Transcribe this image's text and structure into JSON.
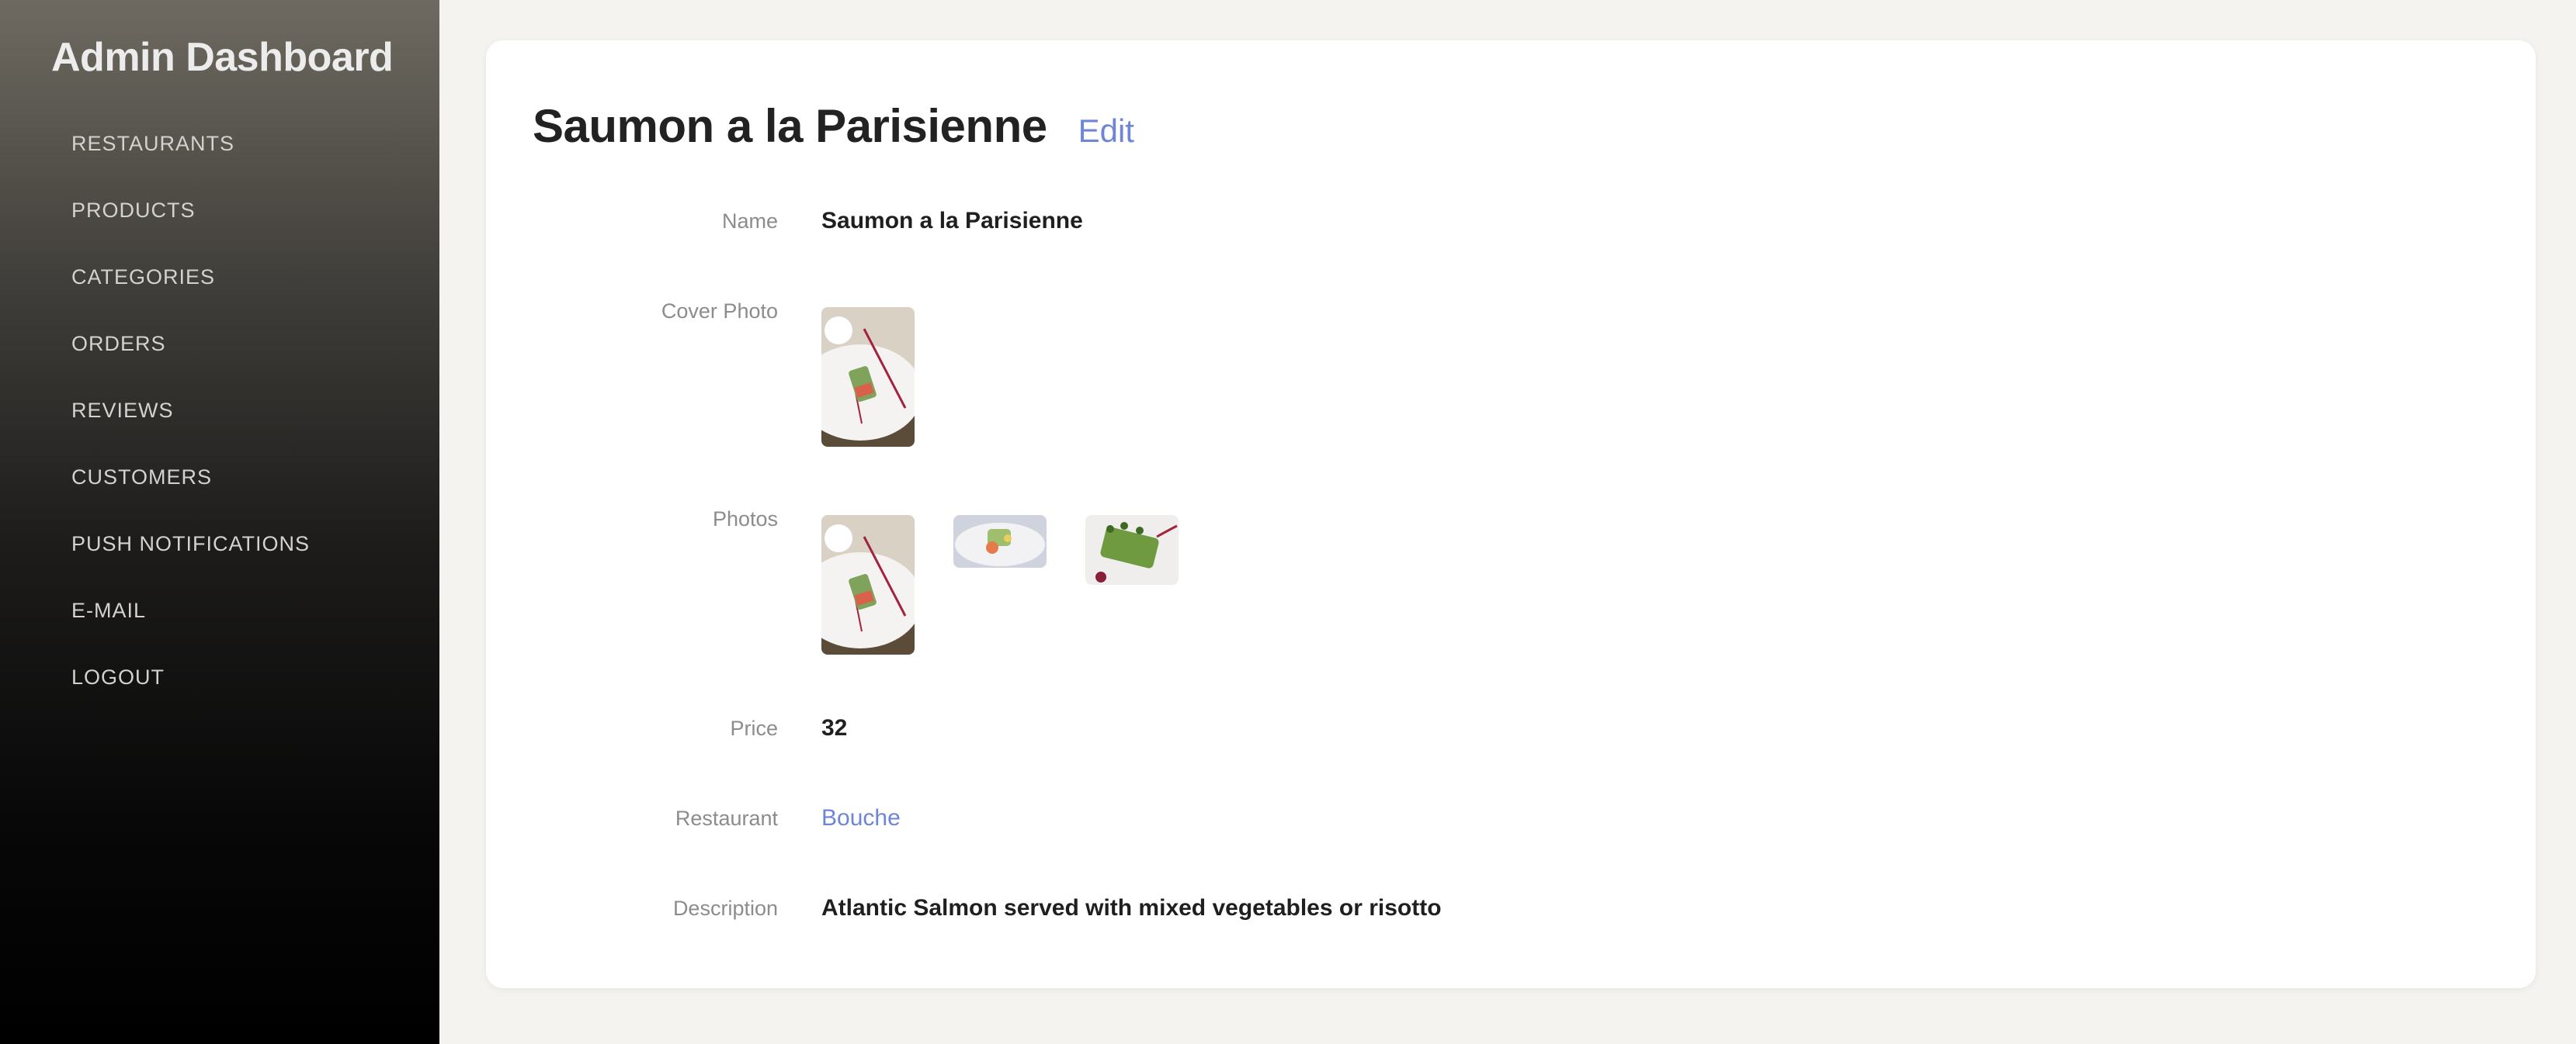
{
  "sidebar": {
    "title": "Admin Dashboard",
    "items": [
      {
        "label": "RESTAURANTS"
      },
      {
        "label": "PRODUCTS"
      },
      {
        "label": "CATEGORIES"
      },
      {
        "label": "ORDERS"
      },
      {
        "label": "REVIEWS"
      },
      {
        "label": "CUSTOMERS"
      },
      {
        "label": "PUSH NOTIFICATIONS"
      },
      {
        "label": "E-MAIL"
      },
      {
        "label": "LOGOUT"
      }
    ]
  },
  "product": {
    "title": "Saumon a la Parisienne",
    "edit_label": "Edit",
    "fields": {
      "name_label": "Name",
      "name_value": "Saumon a la Parisienne",
      "cover_label": "Cover Photo",
      "photos_label": "Photos",
      "price_label": "Price",
      "price_value": "32",
      "restaurant_label": "Restaurant",
      "restaurant_value": "Bouche",
      "description_label": "Description",
      "description_value": "Atlantic Salmon served with mixed vegetables or risotto"
    }
  },
  "colors": {
    "accent_link": "#6f86d6",
    "page_bg": "#f4f3f0"
  }
}
